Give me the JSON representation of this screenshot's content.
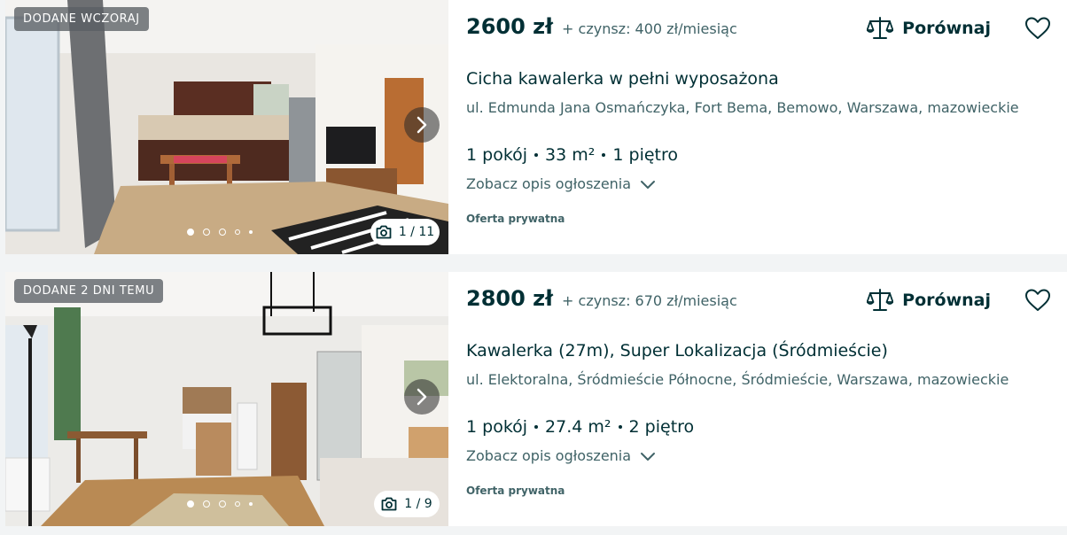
{
  "listings": [
    {
      "badge": "DODANE WCZORAJ",
      "price": "2600 zł",
      "rent": "+ czynsz: 400 zł/miesiąc",
      "compare_label": "Porównaj",
      "title": "Cicha kawalerka w pełni wyposażona",
      "address": "ul. Edmunda Jana Osmańczyka, Fort Bema, Bemowo, Warszawa, mazowieckie",
      "rooms": "1 pokój",
      "area": "33 m²",
      "floor": "1 piętro",
      "description_link": "Zobacz opis ogłoszenia",
      "seller": "Oferta prywatna",
      "photo_counter": "1 / 11"
    },
    {
      "badge": "DODANE 2 DNI TEMU",
      "price": "2800 zł",
      "rent": "+ czynsz: 670 zł/miesiąc",
      "compare_label": "Porównaj",
      "title": "Kawalerka (27m), Super Lokalizacja (Śródmieście)",
      "address": "ul. Elektoralna, Śródmieście Północne, Śródmieście, Warszawa, mazowieckie",
      "rooms": "1 pokój",
      "area": "27.4 m²",
      "floor": "2 piętro",
      "description_link": "Zobacz opis ogłoszenia",
      "seller": "Oferta prywatna",
      "photo_counter": "1 / 9"
    }
  ],
  "colors": {
    "text_primary": "#002f34",
    "text_secondary": "#406367",
    "page_bg": "#f2f4f5"
  },
  "icons": [
    "chevron-right-icon",
    "camera-icon",
    "scales-icon",
    "heart-icon",
    "chevron-down-icon"
  ]
}
